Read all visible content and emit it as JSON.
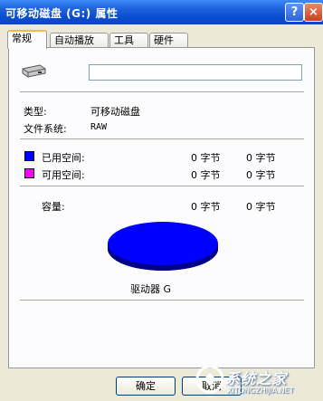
{
  "window": {
    "title": "可移动磁盘 (G:) 属性",
    "help_glyph": "?",
    "close_glyph": "×"
  },
  "tabs": [
    {
      "label": "常规",
      "active": true
    },
    {
      "label": "自动播放",
      "active": false
    },
    {
      "label": "工具",
      "active": false
    },
    {
      "label": "硬件",
      "active": false
    }
  ],
  "general": {
    "volume_name": "",
    "type_label": "类型:",
    "type_value": "可移动磁盘",
    "fs_label": "文件系统:",
    "fs_value": "RAW",
    "used_label": "已用空间:",
    "used_bytes": "0 字节",
    "used_size": "0 字节",
    "free_label": "可用空间:",
    "free_bytes": "0 字节",
    "free_size": "0 字节",
    "capacity_label": "容量:",
    "capacity_bytes": "0 字节",
    "capacity_size": "0 字节",
    "drive_label": "驱动器 G",
    "used_color": "#0000ff",
    "free_color": "#ff00ff"
  },
  "buttons": {
    "ok": "确定",
    "cancel": "取消"
  },
  "watermark": {
    "text": "系统之家",
    "url": "XITONGZHIJIA.NET"
  }
}
